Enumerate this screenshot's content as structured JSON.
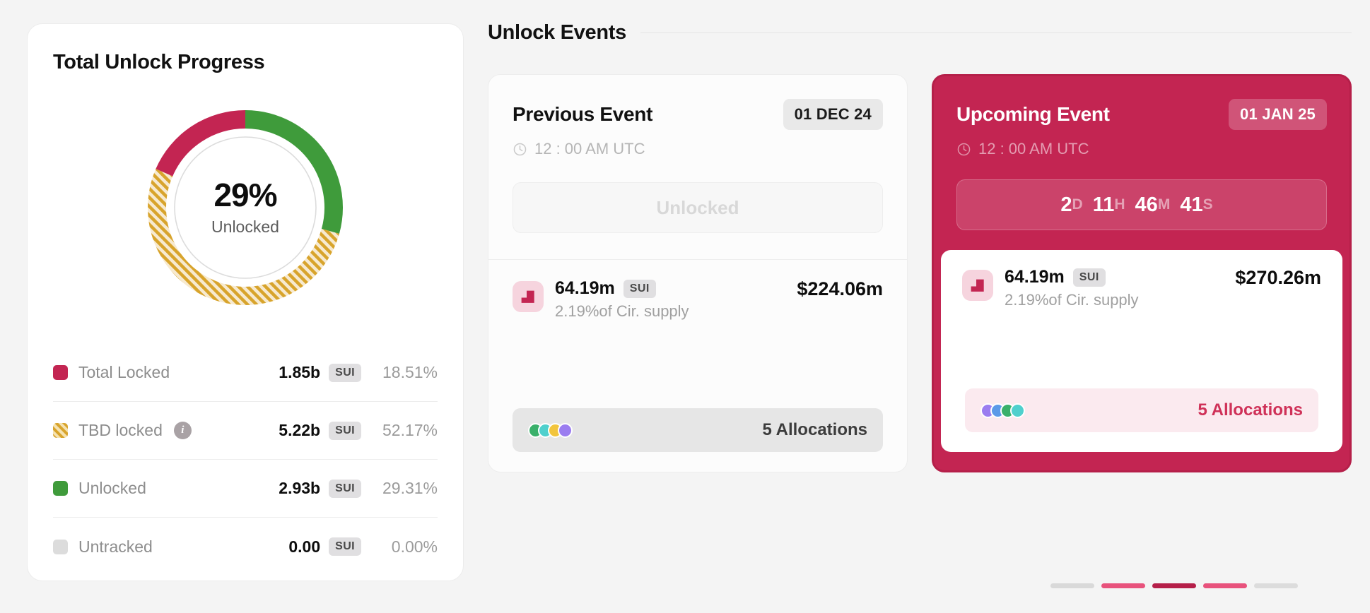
{
  "progress": {
    "title": "Total Unlock Progress",
    "donut": {
      "percent_label": "29%",
      "sub_label": "Unlocked"
    },
    "legend": [
      {
        "label": "Total Locked",
        "amount": "1.85b",
        "unit": "SUI",
        "percent": "18.51%",
        "swatch": "locked-swatch",
        "info": false
      },
      {
        "label": "TBD locked",
        "amount": "5.22b",
        "unit": "SUI",
        "percent": "52.17%",
        "swatch": "tbd-swatch",
        "info": true,
        "info_icon": "info-icon"
      },
      {
        "label": "Unlocked",
        "amount": "2.93b",
        "unit": "SUI",
        "percent": "29.31%",
        "swatch": "unlocked-swatch",
        "info": false
      },
      {
        "label": "Untracked",
        "amount": "0.00",
        "unit": "SUI",
        "percent": "0.00%",
        "swatch": "untracked-swatch",
        "info": false
      }
    ]
  },
  "events": {
    "section_title": "Unlock Events",
    "previous": {
      "title": "Previous Event",
      "date": "01 DEC 24",
      "time": "12 : 00 AM UTC",
      "clock_icon": "clock-icon",
      "status": "Unlocked",
      "token": {
        "icon": "token-icon",
        "amount": "64.19m",
        "unit": "SUI",
        "supply": "2.19%of Cir. supply",
        "usd": "$224.06m"
      },
      "allocations_label": "5 Allocations",
      "allocation_dots": [
        "#39b06a",
        "#4fd0cd",
        "#f2c53d",
        "#9b7df0",
        "#9b7df0"
      ]
    },
    "upcoming": {
      "title": "Upcoming Event",
      "date": "01 JAN 25",
      "time": "12 : 00 AM UTC",
      "clock_icon": "clock-icon",
      "countdown": [
        {
          "value": "2",
          "unit": "D"
        },
        {
          "value": "11",
          "unit": "H"
        },
        {
          "value": "46",
          "unit": "M"
        },
        {
          "value": "41",
          "unit": "S"
        }
      ],
      "token": {
        "icon": "token-icon",
        "amount": "64.19m",
        "unit": "SUI",
        "supply": "2.19%of Cir. supply",
        "usd": "$270.26m"
      },
      "allocations_label": "5 Allocations",
      "allocation_dots": [
        "#9b7df0",
        "#5b9ae8",
        "#39b06a",
        "#4fd0cd",
        "#4fd0cd"
      ]
    },
    "pagination": [
      "#d9d9d9",
      "#e8527c",
      "#b51f49",
      "#e8527c",
      "#dcdcdc"
    ]
  },
  "chart_data": {
    "type": "pie",
    "title": "Total Unlock Progress",
    "labels": [
      "Unlocked",
      "TBD locked",
      "Total Locked",
      "Untracked"
    ],
    "values": [
      29.31,
      52.17,
      18.51,
      0.0
    ],
    "amounts": [
      "2.93b",
      "5.22b",
      "1.85b",
      "0.00"
    ],
    "unit": "SUI",
    "colors": [
      "#3f9b3b",
      "#d8a42c",
      "#c32552",
      "#dcdcdc"
    ],
    "center_label": "29%",
    "center_sublabel": "Unlocked",
    "legend_position": "below"
  },
  "colors": {
    "crimson": "#c32552",
    "green": "#3f9b3b",
    "gold": "#d8a42c",
    "gray": "#dcdcdc"
  }
}
